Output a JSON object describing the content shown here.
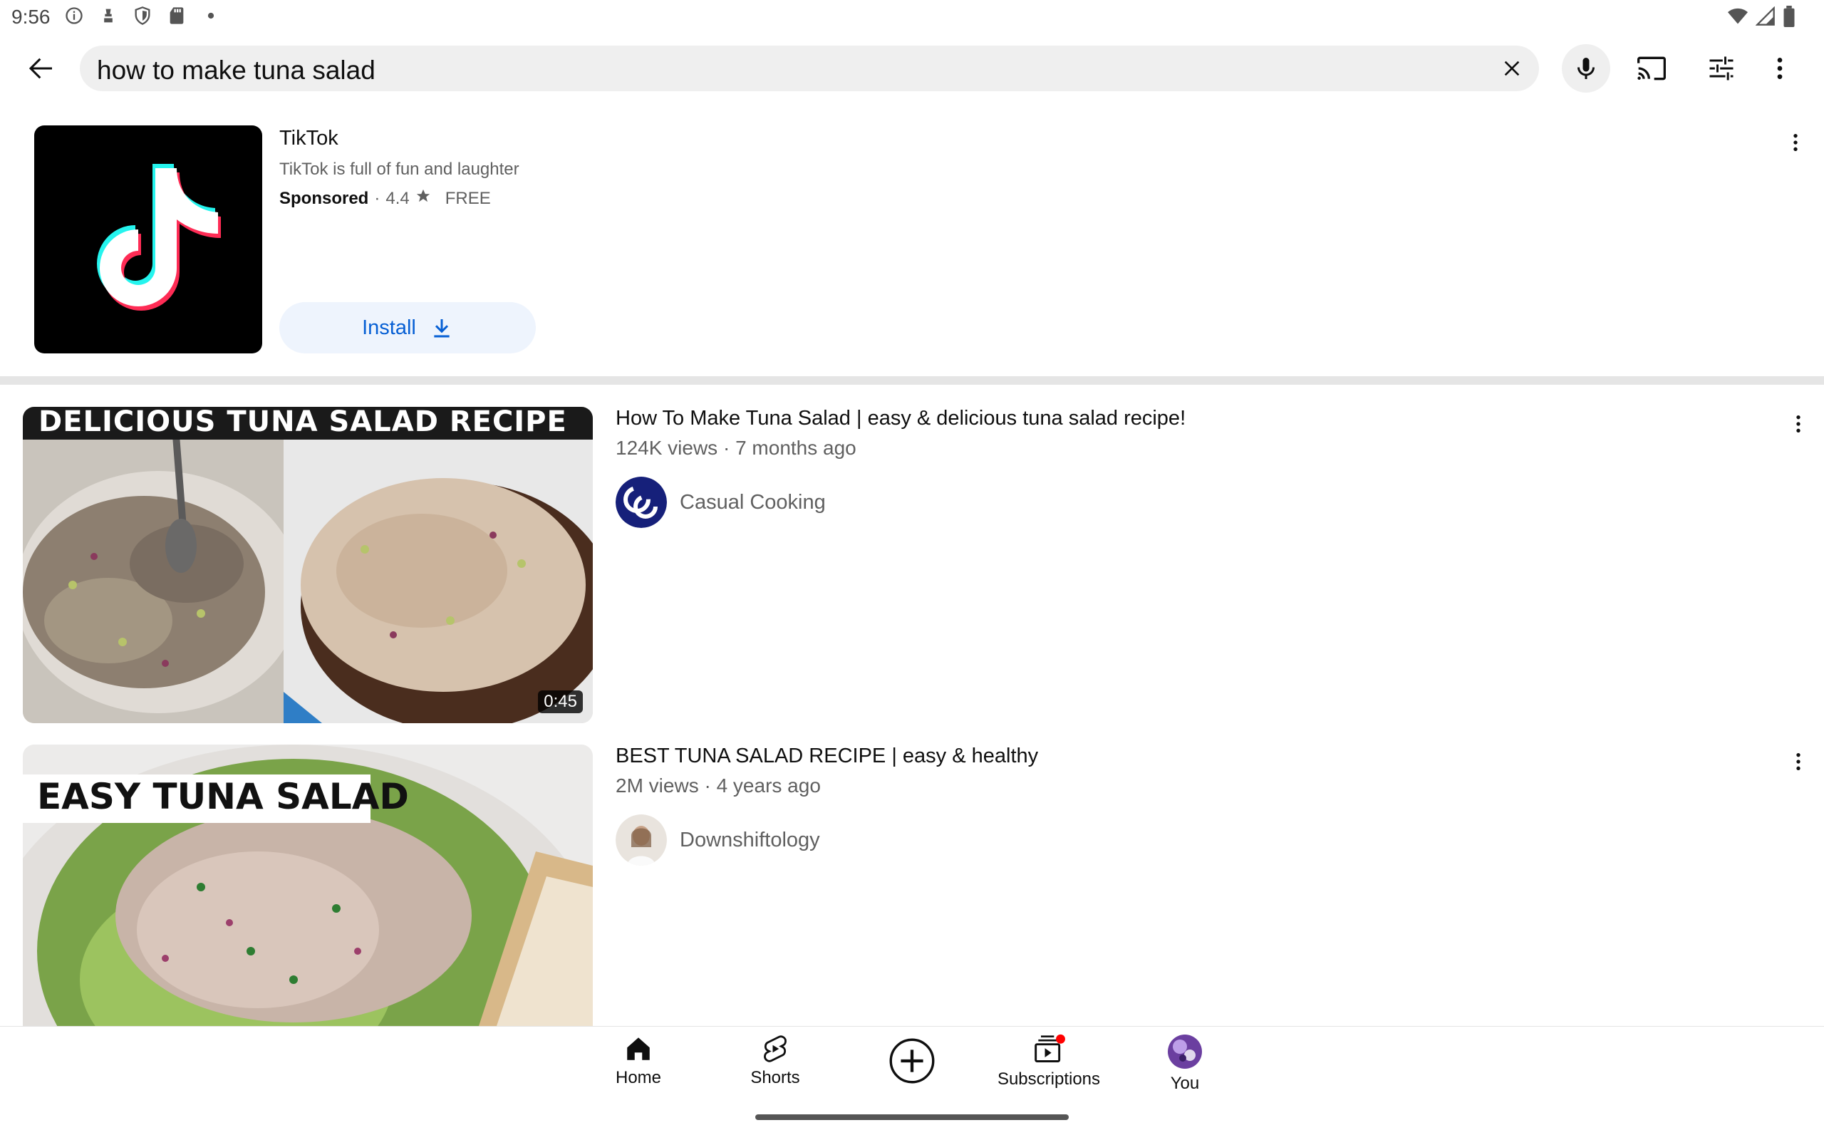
{
  "status_bar": {
    "time": "9:56"
  },
  "search": {
    "query": "how to make tuna salad"
  },
  "ad": {
    "title": "TikTok",
    "description": "TikTok is full of fun and laughter",
    "sponsored_label": "Sponsored",
    "rating": "4.4",
    "price": "FREE",
    "install_label": "Install"
  },
  "videos": [
    {
      "title": "How To Make Tuna Salad | easy & delicious tuna salad recipe!",
      "meta": "124K views · 7 months ago",
      "channel": "Casual Cooking",
      "duration": "0:45",
      "thumb_caption": "DELICIOUS TUNA SALAD RECIPE"
    },
    {
      "title": "BEST TUNA SALAD RECIPE | easy & healthy",
      "meta": "2M views · 4 years ago",
      "channel": "Downshiftology",
      "thumb_caption": "EASY TUNA SALAD"
    }
  ],
  "bottom_nav": {
    "home": "Home",
    "shorts": "Shorts",
    "subscriptions": "Subscriptions",
    "you": "You"
  },
  "colors": {
    "accent_blue": "#065fd4",
    "tiktok_cyan": "#25f4ee",
    "tiktok_red": "#fe2c55",
    "notification_red": "#ff0000"
  }
}
